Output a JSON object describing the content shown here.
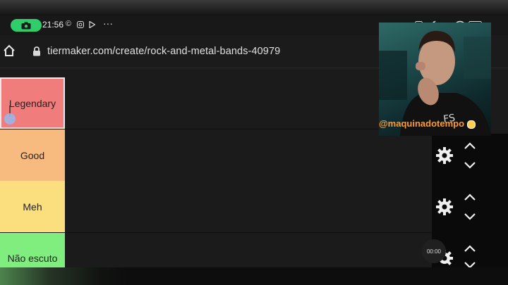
{
  "status": {
    "time": "21:56",
    "dots": "···"
  },
  "browser": {
    "url": "tiermaker.com/create/rock-and-metal-bands-40979"
  },
  "tiers": [
    {
      "label": "Legendary",
      "color": "#f07c7c"
    },
    {
      "label": "Good",
      "color": "#f8bb7f"
    },
    {
      "label": "Meh",
      "color": "#fbdf7f"
    },
    {
      "label": "Não escuto",
      "color": "#7fee7f"
    }
  ],
  "webcam": {
    "handle": "@maquinadotempo"
  },
  "timer": {
    "value": "00:00"
  }
}
